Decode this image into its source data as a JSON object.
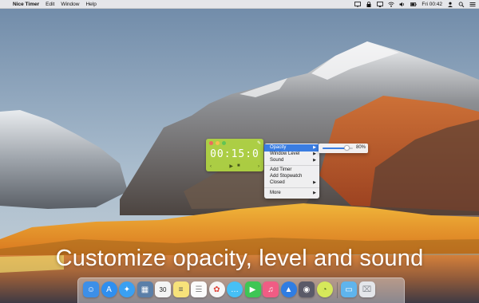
{
  "menubar": {
    "apple": "",
    "app_name": "Nice Timer",
    "menus": [
      "Edit",
      "Window",
      "Help"
    ],
    "clock": "Fri 00:42",
    "status_icons": [
      "display-icon",
      "lock-icon",
      "screen-mirror-icon",
      "wifi-icon",
      "volume-icon",
      "battery-icon"
    ],
    "user_icon": "user-icon",
    "search_icon": "spotlight-icon",
    "list_icon": "notification-center-icon"
  },
  "timer": {
    "display": "00:15:0",
    "controls_left": "‹",
    "controls_middle": [
      "▶",
      "■"
    ],
    "controls_right": "›",
    "color": "#b2d840"
  },
  "context_menu": {
    "items": [
      {
        "label": "Opacity",
        "has_submenu": true,
        "highlighted": true
      },
      {
        "label": "Window Level",
        "has_submenu": true,
        "highlighted": false
      },
      {
        "label": "Sound",
        "has_submenu": true,
        "highlighted": false
      },
      {
        "label": "Add Timer",
        "has_submenu": false,
        "highlighted": false
      },
      {
        "label": "Add Stopwatch",
        "has_submenu": false,
        "highlighted": false
      },
      {
        "label": "Closed",
        "has_submenu": true,
        "highlighted": false
      },
      {
        "label": "More",
        "has_submenu": true,
        "highlighted": false
      }
    ]
  },
  "opacity_slider": {
    "value": 0.8,
    "label": "80%"
  },
  "caption": "Customize opacity, level and sound",
  "dock": {
    "icons": [
      {
        "name": "finder-icon",
        "glyph": "☺",
        "color": "#3d8fe8"
      },
      {
        "name": "app-store-icon",
        "glyph": "A",
        "color": "#2f8ff0",
        "round": true
      },
      {
        "name": "safari-icon",
        "glyph": "✦",
        "color": "#3aa0f2",
        "round": true
      },
      {
        "name": "preview-icon",
        "glyph": "▦",
        "color": "#5b7fa8"
      },
      {
        "name": "calendar-icon",
        "glyph": "30",
        "color": "#f4f4f4",
        "text_color": "#222"
      },
      {
        "name": "notes-icon",
        "glyph": "≡",
        "color": "#f7e27a",
        "text_color": "#555"
      },
      {
        "name": "reminders-icon",
        "glyph": "☰",
        "color": "#fbfbfb",
        "text_color": "#888"
      },
      {
        "name": "photos-icon",
        "glyph": "✿",
        "color": "#f6f6f6",
        "text_color": "#e0463c",
        "round": true
      },
      {
        "name": "messages-icon",
        "glyph": "…",
        "color": "#46c0f5",
        "round": true
      },
      {
        "name": "facetime-icon",
        "glyph": "▶",
        "color": "#3ec654"
      },
      {
        "name": "music-icon",
        "glyph": "♫",
        "color": "#f05c84"
      },
      {
        "name": "launchpad-icon",
        "glyph": "▲",
        "color": "#2f7de3",
        "round": true
      },
      {
        "name": "photo-booth-icon",
        "glyph": "◉",
        "color": "#5a5a68"
      },
      {
        "name": "nice-timer-icon",
        "glyph": "◔",
        "color": "#d6e85a",
        "text_color": "#557020",
        "round": true
      },
      {
        "name": "downloads-folder-icon",
        "glyph": "▭",
        "color": "#5fb4ec"
      },
      {
        "name": "trash-icon",
        "glyph": "⌧",
        "color": "#e4e6ea",
        "text_color": "#8a8f96"
      }
    ]
  }
}
